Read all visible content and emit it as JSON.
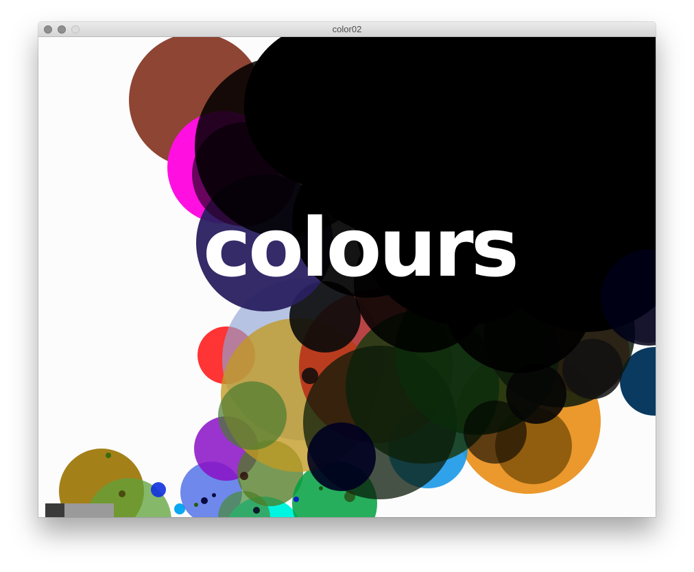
{
  "window": {
    "title": "color02"
  },
  "canvas": {
    "background": "#fcfcfc",
    "overlay_text": "colours",
    "overlay_text_color": "#ffffff",
    "swatches": {
      "dark_color": "#3a3a3a",
      "light_color": "#9a9a9a"
    }
  },
  "icons": {
    "close": "close-button-icon",
    "minimize": "minimize-button-icon",
    "zoom": "zoom-button-icon"
  }
}
